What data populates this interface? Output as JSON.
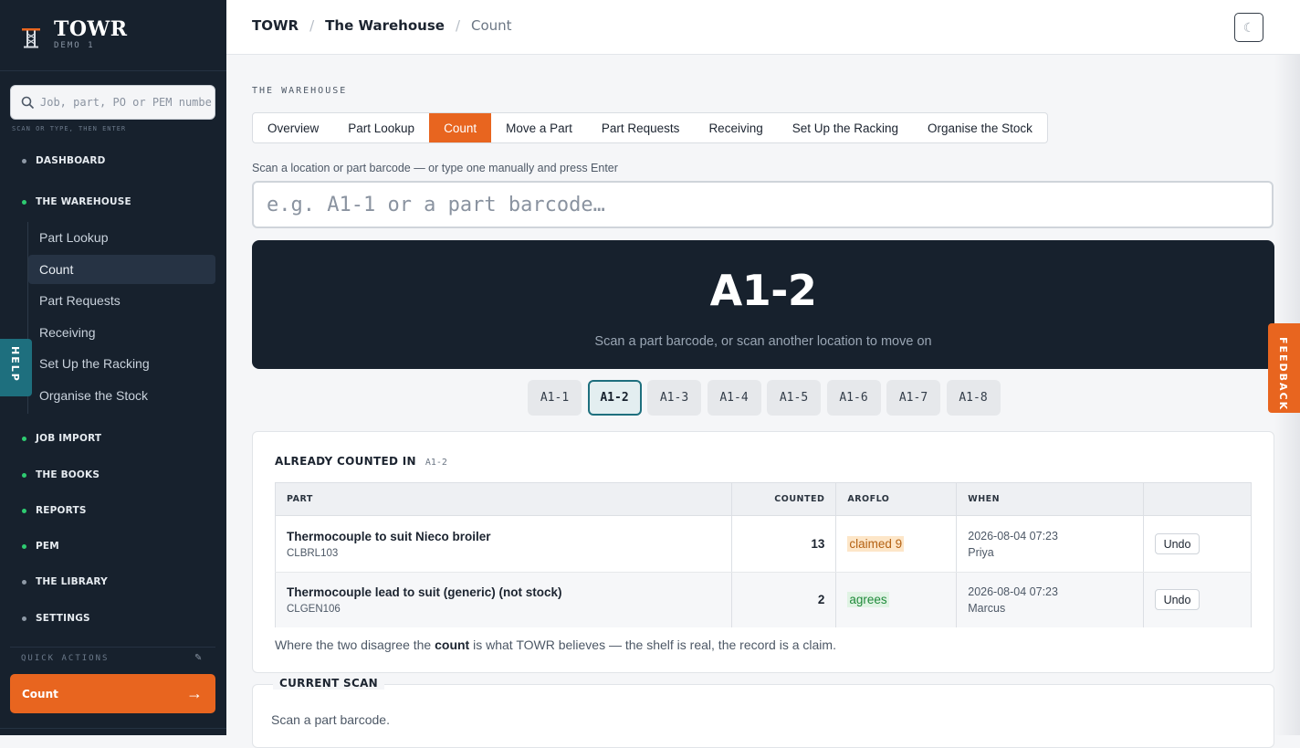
{
  "brand": {
    "name": "TOWR",
    "sub": "DEMO 1",
    "accent": "#e8651f"
  },
  "search": {
    "placeholder": "Job, part, PO or PEM number",
    "hint": "SCAN OR TYPE, THEN ENTER"
  },
  "nav": {
    "dashboard": "DASHBOARD",
    "warehouse": "THE WAREHOUSE",
    "warehouse_items": [
      "Part Lookup",
      "Count",
      "Part Requests",
      "Receiving",
      "Set Up the Racking",
      "Organise the Stock"
    ],
    "job_import": "JOB IMPORT",
    "books": "THE BOOKS",
    "reports": "REPORTS",
    "pem": "PEM",
    "library": "THE LIBRARY",
    "settings": "SETTINGS"
  },
  "quick_actions": {
    "label": "QUICK ACTIONS",
    "button": "Count",
    "arrow": "→"
  },
  "help_tab": "HELP",
  "feedback_tab": "FEEDBACK",
  "breadcrumb": [
    "TOWR",
    "The Warehouse",
    "Count"
  ],
  "breadcrumb_sep": "/",
  "theme_icon": "☾",
  "eyebrow": "THE WAREHOUSE",
  "tabs": [
    "Overview",
    "Part Lookup",
    "Count",
    "Move a Part",
    "Part Requests",
    "Receiving",
    "Set Up the Racking",
    "Organise the Stock"
  ],
  "active_tab": "Count",
  "scan": {
    "label": "Scan a location or part barcode — or type one manually and press Enter",
    "placeholder": "e.g. A1-1 or a part barcode…"
  },
  "hero": {
    "location": "A1-2",
    "hint": "Scan a part barcode, or scan another location to move on"
  },
  "locations": [
    "A1-1",
    "A1-2",
    "A1-3",
    "A1-4",
    "A1-5",
    "A1-6",
    "A1-7",
    "A1-8"
  ],
  "active_location": "A1-2",
  "counted": {
    "title": "ALREADY COUNTED IN",
    "location": "A1-2",
    "columns": [
      "PART",
      "COUNTED",
      "AROFLO",
      "WHEN",
      ""
    ],
    "rows": [
      {
        "name": "Thermocouple to suit Nieco broiler",
        "code": "CLBRL103",
        "counted": "13",
        "aroflo": "claimed 9",
        "aroflo_status": "claimed",
        "date": "2026-08-04 07:23",
        "user": "Priya",
        "action": "Undo"
      },
      {
        "name": "Thermocouple lead to suit (generic) (not stock)",
        "code": "CLGEN106",
        "counted": "2",
        "aroflo": "agrees",
        "aroflo_status": "agrees",
        "date": "2026-08-04 07:23",
        "user": "Marcus",
        "action": "Undo"
      }
    ],
    "note_before": "Where the two disagree the ",
    "note_bold": "count",
    "note_after": " is what TOWR believes — the shelf is real, the record is a claim."
  },
  "current_scan": {
    "title": "CURRENT SCAN",
    "text": "Scan a part barcode."
  }
}
